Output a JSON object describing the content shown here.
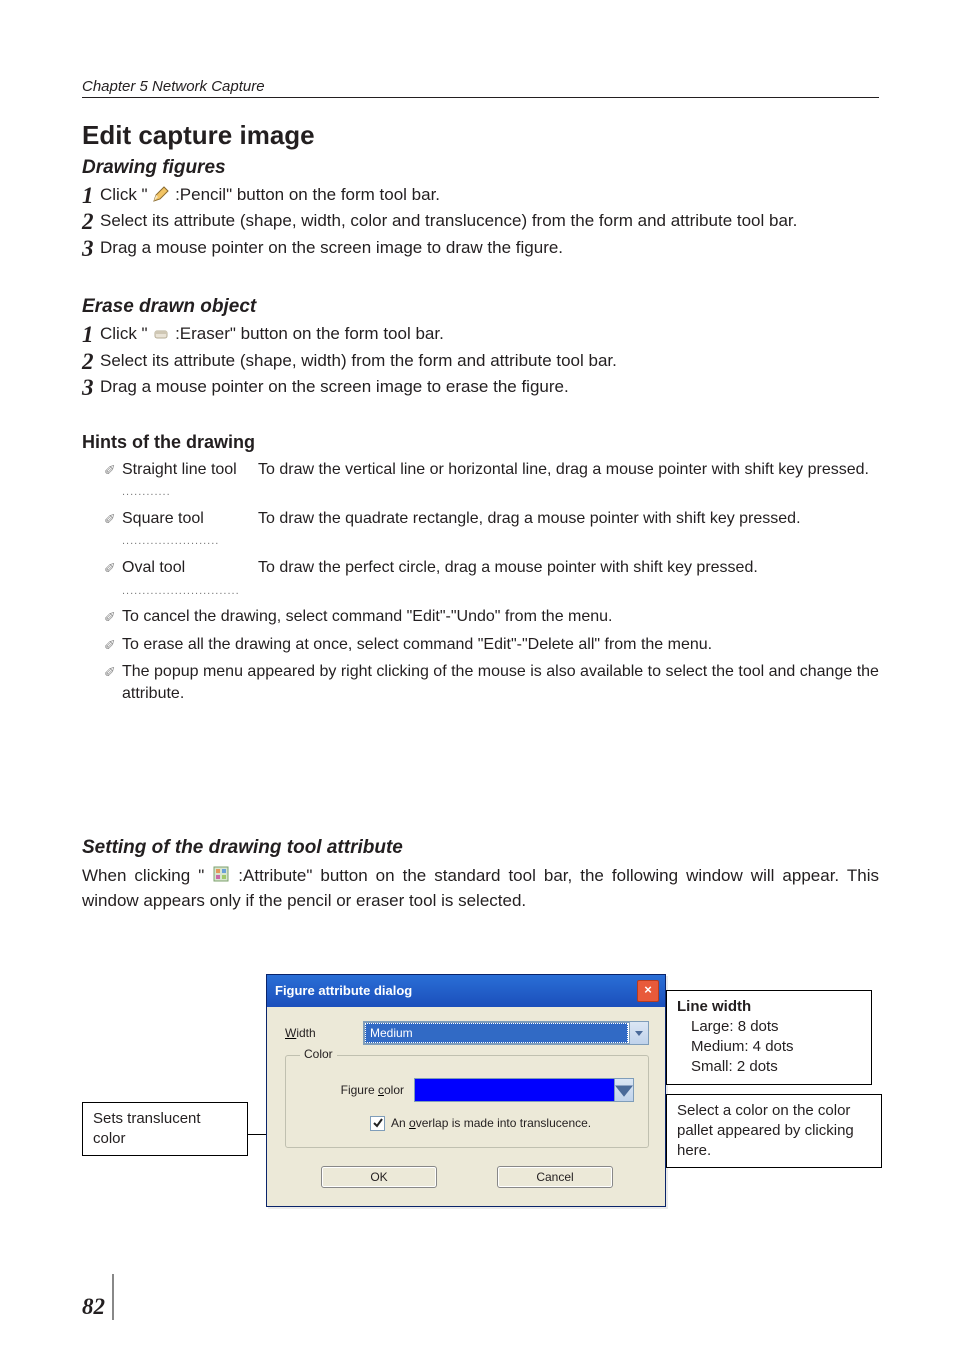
{
  "chapter": "Chapter 5 Network Capture",
  "title": "Edit capture image",
  "drawing": {
    "heading": "Drawing figures",
    "steps": [
      {
        "pre": "Click \"",
        "icon": "pencil",
        "post": ":Pencil\" button on the form tool bar."
      },
      {
        "text": "Select its attribute (shape, width, color and translucence) from the form and attribute tool bar."
      },
      {
        "text": "Drag a mouse pointer on the screen image to draw the figure."
      }
    ]
  },
  "erase": {
    "heading": "Erase drawn object",
    "steps": [
      {
        "pre": "Click \"",
        "icon": "eraser",
        "post": ":Eraser\" button on the form tool bar."
      },
      {
        "text": "Select its attribute (shape, width) from the form and attribute tool bar."
      },
      {
        "text": "Drag a mouse pointer on the screen image to erase the figure."
      }
    ]
  },
  "hints": {
    "heading": "Hints of the drawing",
    "defs": [
      {
        "term": "Straight line tool",
        "def": "To draw the vertical line or horizontal line, drag a mouse pointer with shift key pressed."
      },
      {
        "term": "Square tool",
        "def": "To draw the quadrate rectangle, drag a mouse pointer with shift key pressed."
      },
      {
        "term": "Oval tool",
        "def": "To draw the perfect circle, drag a mouse pointer with shift key pressed."
      }
    ],
    "lines": [
      "To cancel the drawing, select command \"Edit\"-\"Undo\" from the menu.",
      "To erase all the drawing at once, select command \"Edit\"-\"Delete all\" from the menu.",
      "The popup menu appeared by right clicking of the mouse is also available to select the tool and change the attribute."
    ]
  },
  "attr_section": {
    "heading": "Setting of the drawing tool attribute",
    "body_pre": "When clicking \"",
    "body_post": ":Attribute\" button on the standard tool bar, the following window will appear. This window appears only if the pencil or eraser tool is selected."
  },
  "dialog": {
    "title": "Figure attribute dialog",
    "width_label": "Width",
    "width_value": "Medium",
    "color_group": "Color",
    "figure_color_label": "Figure color",
    "checkbox_label": "An overlap is made into translucence.",
    "ok": "OK",
    "cancel": "Cancel"
  },
  "callouts": {
    "left": "Sets translucent color",
    "right1_title": "Line width",
    "right1_l1": "Large: 8 dots",
    "right1_l2": "Medium: 4 dots",
    "right1_l3": "Small: 2 dots",
    "right2": "Select a color on the color pallet appeared by clicking here."
  },
  "page_number": "82"
}
